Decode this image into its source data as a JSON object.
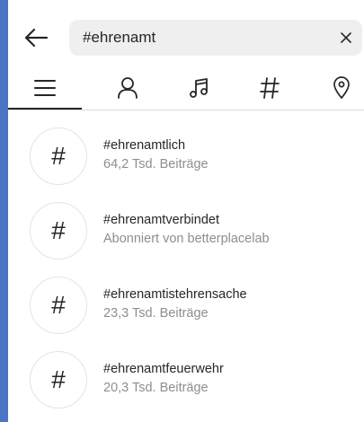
{
  "search": {
    "value": "#ehrenamt",
    "back_icon": "arrow-left-icon",
    "clear_icon": "close-icon"
  },
  "tabs": [
    {
      "name": "top",
      "icon": "list-icon",
      "active": true
    },
    {
      "name": "accounts",
      "icon": "person-icon",
      "active": false
    },
    {
      "name": "audio",
      "icon": "music-note-icon",
      "active": false
    },
    {
      "name": "tags",
      "icon": "hashtag-icon",
      "active": false
    },
    {
      "name": "places",
      "icon": "location-pin-icon",
      "active": false
    }
  ],
  "results": [
    {
      "symbol": "#",
      "title": "#ehrenamtlich",
      "subtitle": "64,2 Tsd. Beiträge"
    },
    {
      "symbol": "#",
      "title": "#ehrenamtverbindet",
      "subtitle": "Abonniert von betterplacelab"
    },
    {
      "symbol": "#",
      "title": "#ehrenamtistehrensache",
      "subtitle": "23,3 Tsd. Beiträge"
    },
    {
      "symbol": "#",
      "title": "#ehrenamtfeuerwehr",
      "subtitle": "20,3 Tsd. Beiträge"
    }
  ],
  "colors": {
    "background_outer": "#4a74c4",
    "text_primary": "#262626",
    "text_secondary": "#8e8e8e",
    "search_bg": "#efefef"
  }
}
